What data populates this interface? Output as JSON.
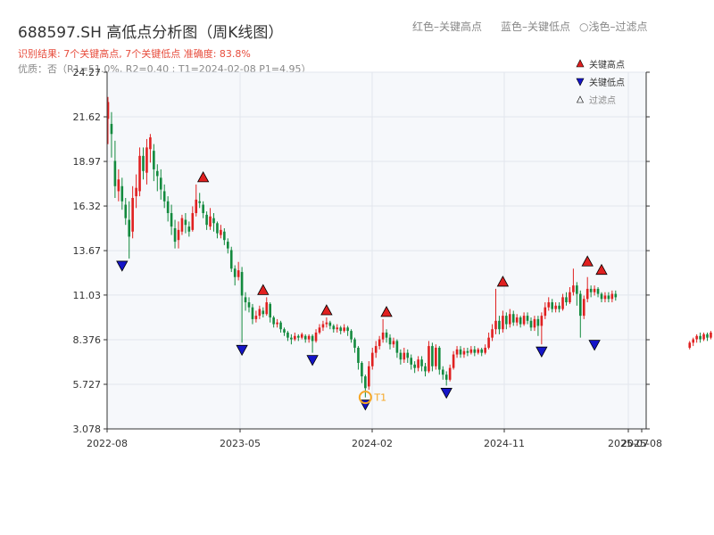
{
  "title": "688597.SH 高低点分析图（周K线图）",
  "hints": [
    "红色–关键高点",
    "蓝色–关键低点",
    "○浅色–过滤点"
  ],
  "subtitle": "识别结果: 7个关键高点, 7个关键低点   准确度: 83.8%",
  "quality_line": "优质：否（R1=51.0%, R2=0.40 ; T1=2024-02-08 P1=4.95）",
  "colors": {
    "up": "#e02020",
    "down": "#138a3e",
    "high_marker": "#e02020",
    "low_marker": "#1515c8",
    "t1": "#f5a623",
    "plot_bg": "#f6f8fb"
  },
  "chart_data": {
    "type": "candlestick",
    "x_ticks": [
      "2022-08",
      "2023-05",
      "2024-02",
      "2024-11",
      "2025-07",
      "2025-08"
    ],
    "y_ticks": [
      "3.078",
      "5.727",
      "8.376",
      "11.03",
      "13.67",
      "16.32",
      "18.97",
      "21.62",
      "24.27"
    ],
    "ylim": [
      3.078,
      24.27
    ],
    "legend": [
      {
        "label": "关键高点",
        "marker": "up-triangle-red"
      },
      {
        "label": "关键低点",
        "marker": "down-triangle-blue"
      },
      {
        "label": "过滤点",
        "marker": "up-triangle-hollow"
      }
    ],
    "t1": {
      "label": "T1",
      "price": 4.95,
      "date": "2024-02-08"
    },
    "key_highs": [
      {
        "date": "2022-12",
        "price": 17.6
      },
      {
        "date": "2023-06",
        "price": 10.9
      },
      {
        "date": "2023-10",
        "price": 9.7
      },
      {
        "date": "2024-02",
        "price": 9.6
      },
      {
        "date": "2024-10",
        "price": 11.4
      },
      {
        "date": "2025-03",
        "price": 12.6
      },
      {
        "date": "2025-04",
        "price": 12.1
      }
    ],
    "key_lows": [
      {
        "date": "2022-08",
        "price": 13.2
      },
      {
        "date": "2023-05",
        "price": 8.2
      },
      {
        "date": "2023-09",
        "price": 7.6
      },
      {
        "date": "2024-02",
        "price": 4.95
      },
      {
        "date": "2024-07",
        "price": 5.65
      },
      {
        "date": "2025-01",
        "price": 8.1
      },
      {
        "date": "2025-04",
        "price": 8.5
      }
    ],
    "candles": {
      "fields": [
        "open",
        "close",
        "high",
        "low"
      ],
      "values": [
        [
          21.5,
          22.5,
          22.8,
          20.0
        ],
        [
          21.2,
          20.6,
          21.9,
          19.2
        ],
        [
          19.0,
          17.5,
          20.2,
          16.8
        ],
        [
          17.2,
          17.9,
          18.5,
          16.6
        ],
        [
          17.5,
          16.6,
          18.0,
          16.1
        ],
        [
          16.4,
          15.6,
          16.8,
          15.2
        ],
        [
          15.5,
          14.5,
          16.6,
          13.2
        ],
        [
          14.8,
          16.8,
          17.5,
          14.4
        ],
        [
          16.9,
          17.4,
          18.2,
          16.2
        ],
        [
          17.2,
          19.3,
          19.8,
          16.9
        ],
        [
          19.3,
          18.4,
          19.8,
          17.9
        ],
        [
          18.3,
          19.8,
          20.3,
          17.6
        ],
        [
          19.7,
          20.4,
          20.6,
          18.9
        ],
        [
          19.6,
          18.5,
          20.0,
          17.8
        ],
        [
          18.4,
          18.1,
          18.8,
          17.2
        ],
        [
          18.0,
          17.3,
          18.5,
          16.7
        ],
        [
          17.2,
          16.6,
          17.6,
          16.2
        ],
        [
          16.6,
          15.9,
          16.9,
          15.4
        ],
        [
          15.9,
          15.1,
          16.4,
          14.6
        ],
        [
          15.0,
          14.2,
          15.5,
          13.8
        ],
        [
          14.3,
          14.9,
          15.4,
          13.8
        ],
        [
          14.8,
          15.6,
          15.8,
          14.6
        ],
        [
          15.5,
          15.2,
          15.9,
          14.7
        ],
        [
          15.1,
          14.8,
          15.4,
          14.5
        ],
        [
          14.9,
          15.9,
          16.3,
          14.8
        ],
        [
          15.9,
          16.7,
          17.6,
          15.7
        ],
        [
          16.6,
          16.5,
          17.1,
          16.2
        ],
        [
          16.4,
          15.9,
          16.6,
          15.6
        ],
        [
          15.8,
          15.2,
          16.0,
          14.9
        ],
        [
          15.1,
          15.7,
          16.2,
          14.9
        ],
        [
          15.6,
          15.3,
          15.9,
          14.8
        ],
        [
          15.3,
          14.7,
          15.4,
          14.4
        ],
        [
          14.6,
          14.9,
          15.2,
          14.4
        ],
        [
          14.8,
          14.3,
          15.0,
          14.0
        ],
        [
          14.2,
          13.8,
          14.4,
          13.5
        ],
        [
          13.7,
          12.6,
          13.9,
          12.4
        ],
        [
          12.6,
          12.1,
          12.8,
          11.6
        ],
        [
          12.1,
          12.5,
          13.0,
          11.9
        ],
        [
          12.4,
          11.0,
          12.7,
          8.2
        ],
        [
          10.9,
          10.6,
          11.2,
          10.1
        ],
        [
          10.6,
          10.3,
          10.9,
          10.0
        ],
        [
          10.3,
          9.6,
          10.5,
          9.3
        ],
        [
          9.6,
          9.8,
          10.1,
          9.4
        ],
        [
          9.8,
          10.2,
          10.4,
          9.6
        ],
        [
          10.1,
          9.9,
          10.3,
          9.7
        ],
        [
          9.9,
          10.6,
          10.9,
          9.8
        ],
        [
          10.5,
          9.7,
          10.6,
          9.4
        ],
        [
          9.7,
          9.3,
          9.8,
          9.1
        ],
        [
          9.3,
          9.4,
          9.6,
          9.1
        ],
        [
          9.4,
          9.0,
          9.5,
          8.8
        ],
        [
          9.0,
          8.8,
          9.1,
          8.6
        ],
        [
          8.8,
          8.5,
          8.9,
          8.3
        ],
        [
          8.5,
          8.4,
          8.7,
          8.1
        ],
        [
          8.4,
          8.6,
          8.8,
          8.3
        ],
        [
          8.6,
          8.5,
          8.7,
          8.3
        ],
        [
          8.5,
          8.7,
          8.8,
          8.4
        ],
        [
          8.6,
          8.4,
          8.7,
          8.2
        ],
        [
          8.4,
          8.6,
          8.7,
          8.2
        ],
        [
          8.6,
          8.3,
          8.7,
          7.6
        ],
        [
          8.3,
          8.8,
          9.0,
          8.2
        ],
        [
          8.8,
          9.1,
          9.3,
          8.7
        ],
        [
          9.1,
          9.3,
          9.5,
          8.9
        ],
        [
          9.3,
          9.4,
          9.7,
          9.1
        ],
        [
          9.4,
          9.2,
          9.5,
          9.0
        ],
        [
          9.2,
          9.0,
          9.3,
          8.8
        ],
        [
          9.0,
          9.1,
          9.3,
          8.8
        ],
        [
          9.1,
          8.9,
          9.2,
          8.7
        ],
        [
          8.9,
          9.1,
          9.3,
          8.8
        ],
        [
          9.1,
          8.9,
          9.2,
          8.6
        ],
        [
          8.9,
          8.4,
          9.0,
          8.2
        ],
        [
          8.4,
          7.9,
          8.5,
          7.6
        ],
        [
          7.9,
          7.0,
          8.0,
          6.6
        ],
        [
          7.0,
          6.2,
          7.1,
          5.8
        ],
        [
          6.2,
          5.5,
          6.3,
          4.95
        ],
        [
          5.6,
          6.8,
          7.1,
          5.4
        ],
        [
          6.8,
          7.6,
          7.9,
          6.6
        ],
        [
          7.6,
          8.0,
          8.3,
          7.3
        ],
        [
          8.0,
          8.4,
          8.6,
          7.8
        ],
        [
          8.4,
          8.8,
          9.6,
          8.2
        ],
        [
          8.8,
          8.5,
          9.0,
          8.2
        ],
        [
          8.5,
          8.1,
          8.7,
          7.8
        ],
        [
          8.1,
          8.3,
          8.5,
          7.9
        ],
        [
          8.3,
          7.6,
          8.4,
          7.3
        ],
        [
          7.6,
          7.2,
          7.8,
          6.9
        ],
        [
          7.2,
          7.6,
          7.9,
          7.0
        ],
        [
          7.6,
          7.3,
          7.8,
          7.0
        ],
        [
          7.3,
          6.9,
          7.5,
          6.6
        ],
        [
          6.9,
          6.7,
          7.1,
          6.4
        ],
        [
          6.7,
          7.2,
          7.4,
          6.5
        ],
        [
          7.2,
          6.8,
          7.4,
          6.5
        ],
        [
          6.8,
          6.5,
          7.0,
          6.2
        ],
        [
          6.5,
          8.0,
          8.3,
          6.4
        ],
        [
          8.0,
          6.8,
          8.2,
          6.5
        ],
        [
          6.8,
          7.9,
          8.1,
          6.6
        ],
        [
          7.9,
          6.6,
          8.0,
          6.3
        ],
        [
          6.6,
          6.3,
          6.8,
          6.0
        ],
        [
          6.3,
          6.0,
          6.5,
          5.65
        ],
        [
          6.0,
          6.7,
          6.9,
          5.9
        ],
        [
          6.7,
          7.5,
          7.7,
          6.6
        ],
        [
          7.5,
          7.8,
          8.0,
          7.3
        ],
        [
          7.8,
          7.5,
          8.0,
          7.3
        ],
        [
          7.5,
          7.7,
          7.9,
          7.3
        ],
        [
          7.7,
          7.6,
          7.9,
          7.4
        ],
        [
          7.6,
          7.8,
          8.0,
          7.5
        ],
        [
          7.8,
          7.6,
          8.0,
          7.4
        ],
        [
          7.6,
          7.8,
          7.9,
          7.5
        ],
        [
          7.8,
          7.6,
          7.9,
          7.4
        ],
        [
          7.6,
          7.9,
          8.1,
          7.5
        ],
        [
          7.9,
          8.5,
          8.8,
          7.8
        ],
        [
          8.5,
          9.0,
          9.3,
          8.3
        ],
        [
          9.0,
          9.5,
          11.4,
          8.7
        ],
        [
          9.5,
          9.0,
          9.8,
          8.7
        ],
        [
          9.0,
          9.8,
          10.1,
          8.8
        ],
        [
          9.8,
          9.3,
          10.0,
          9.0
        ],
        [
          9.3,
          9.9,
          10.2,
          9.1
        ],
        [
          9.9,
          9.4,
          10.1,
          9.2
        ],
        [
          9.4,
          9.7,
          9.9,
          9.2
        ],
        [
          9.7,
          9.3,
          9.8,
          9.1
        ],
        [
          9.3,
          9.8,
          10.0,
          9.2
        ],
        [
          9.8,
          9.5,
          10.0,
          9.3
        ],
        [
          9.5,
          9.1,
          9.7,
          8.9
        ],
        [
          9.1,
          9.6,
          9.8,
          8.9
        ],
        [
          9.6,
          9.2,
          9.8,
          8.6
        ],
        [
          9.2,
          9.8,
          10.0,
          8.1
        ],
        [
          9.8,
          10.3,
          10.6,
          9.6
        ],
        [
          10.3,
          10.6,
          10.9,
          10.1
        ],
        [
          10.6,
          10.2,
          10.8,
          10.0
        ],
        [
          10.2,
          10.4,
          10.6,
          10.0
        ],
        [
          10.4,
          10.2,
          10.6,
          10.0
        ],
        [
          10.2,
          10.9,
          11.1,
          10.1
        ],
        [
          10.9,
          10.6,
          11.2,
          10.4
        ],
        [
          10.6,
          11.2,
          11.5,
          10.5
        ],
        [
          11.2,
          11.6,
          12.6,
          11.0
        ],
        [
          11.6,
          11.1,
          11.8,
          10.4
        ],
        [
          11.1,
          9.8,
          11.3,
          8.5
        ],
        [
          9.8,
          10.8,
          11.0,
          9.6
        ],
        [
          10.8,
          11.4,
          12.1,
          10.6
        ],
        [
          11.4,
          11.2,
          11.6,
          10.9
        ],
        [
          11.2,
          11.4,
          11.6,
          11.0
        ],
        [
          11.4,
          11.1,
          11.5,
          10.9
        ],
        [
          11.1,
          10.8,
          11.2,
          10.6
        ],
        [
          10.8,
          11.0,
          11.2,
          10.6
        ],
        [
          11.0,
          10.8,
          11.2,
          10.6
        ],
        [
          10.8,
          11.1,
          11.3,
          10.6
        ],
        [
          11.1,
          10.9,
          11.3,
          10.7
        ],
        [
          null,
          null,
          null,
          null
        ],
        [
          null,
          null,
          null,
          null
        ],
        [
          null,
          null,
          null,
          null
        ],
        [
          null,
          null,
          null,
          null
        ],
        [
          null,
          null,
          null,
          null
        ],
        [
          null,
          null,
          null,
          null
        ],
        [
          null,
          null,
          null,
          null
        ],
        [
          null,
          null,
          null,
          null
        ],
        [
          null,
          null,
          null,
          null
        ],
        [
          null,
          null,
          null,
          null
        ],
        [
          null,
          null,
          null,
          null
        ],
        [
          null,
          null,
          null,
          null
        ],
        [
          null,
          null,
          null,
          null
        ],
        [
          null,
          null,
          null,
          null
        ],
        [
          null,
          null,
          null,
          null
        ],
        [
          null,
          null,
          null,
          null
        ],
        [
          null,
          null,
          null,
          null
        ],
        [
          null,
          null,
          null,
          null
        ],
        [
          null,
          null,
          null,
          null
        ],
        [
          null,
          null,
          null,
          null
        ],
        [
          7.9,
          8.2,
          8.3,
          7.8
        ],
        [
          8.2,
          8.4,
          8.5,
          8.0
        ],
        [
          8.4,
          8.6,
          8.7,
          8.2
        ],
        [
          8.6,
          8.4,
          8.8,
          8.2
        ],
        [
          8.4,
          8.7,
          8.8,
          8.3
        ],
        [
          8.7,
          8.5,
          8.8,
          8.3
        ],
        [
          8.5,
          8.8,
          8.9,
          8.4
        ]
      ]
    },
    "marker_index": {
      "highs": [
        27,
        44,
        62,
        79,
        112,
        136,
        140
      ],
      "lows": [
        4,
        38,
        58,
        73,
        96,
        123,
        138
      ]
    }
  }
}
